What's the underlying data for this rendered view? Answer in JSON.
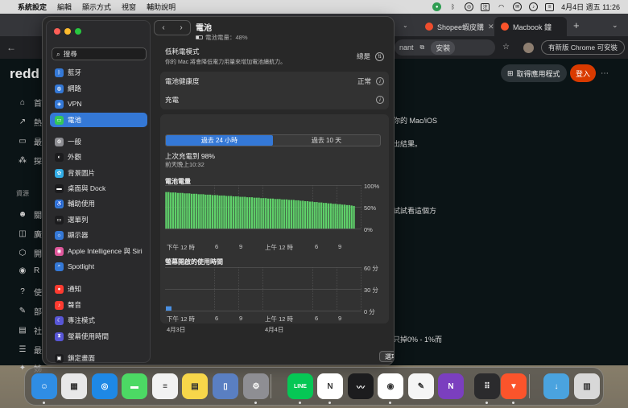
{
  "menubar": {
    "app": "系統設定",
    "items": [
      "編輯",
      "顯示方式",
      "視窗",
      "輔助說明"
    ],
    "status_icons": [
      "github-icon",
      "bluetooth-icon",
      "chatgpt-icon",
      "input-method-icon",
      "wifi-icon",
      "mail-icon",
      "music-icon",
      "control-center-icon"
    ],
    "input_method": "注",
    "datetime": "4月4日 週五 11:26"
  },
  "chrome": {
    "tabs": [
      {
        "label": "Shopee蝦皮購"
      },
      {
        "label": "Macbook 鐘"
      }
    ],
    "address_partial": "nant",
    "install_label": "安裝",
    "update_label": "有新版 Chrome 可安裝",
    "new_tab": "+"
  },
  "reddit": {
    "logo": "redd",
    "get_app": "取得應用程式",
    "login": "登入",
    "section_label": "資源",
    "nav_fragments": [
      "首",
      "熱",
      "最",
      "探",
      "關",
      "廣",
      "開",
      "R",
      "使",
      "部",
      "社",
      "最",
      "姊"
    ],
    "body_text": [
      "你的 Mac/iOS",
      "出結果。",
      "試試看這個方",
      "只掉0% - 1%而"
    ]
  },
  "settings": {
    "search_placeholder": "搜尋",
    "sidebar": [
      {
        "label": "藍牙",
        "icon": "bluetooth-icon",
        "color": "#3478d6"
      },
      {
        "label": "網路",
        "icon": "network-icon",
        "color": "#3478d6"
      },
      {
        "label": "VPN",
        "icon": "vpn-icon",
        "color": "#3478d6"
      },
      {
        "label": "電池",
        "icon": "battery-icon",
        "color": "#34c759",
        "selected": true
      },
      {
        "label": "一般",
        "icon": "gear-icon",
        "color": "#8e8e93"
      },
      {
        "label": "外觀",
        "icon": "appearance-icon",
        "color": "#1c1c1e"
      },
      {
        "label": "背景圖片",
        "icon": "wallpaper-icon",
        "color": "#32ade6"
      },
      {
        "label": "桌面與 Dock",
        "icon": "dock-icon",
        "color": "#1c1c1e"
      },
      {
        "label": "輔助使用",
        "icon": "accessibility-icon",
        "color": "#3478d6"
      },
      {
        "label": "選單列",
        "icon": "menubar-icon",
        "color": "#1c1c1e"
      },
      {
        "label": "顯示器",
        "icon": "display-icon",
        "color": "#3478d6"
      },
      {
        "label": "Apple Intelligence 與 Siri",
        "icon": "siri-icon",
        "color": "#e0579b"
      },
      {
        "label": "Spotlight",
        "icon": "spotlight-icon",
        "color": "#3478d6"
      },
      {
        "label": "通知",
        "icon": "notification-icon",
        "color": "#ff3b30"
      },
      {
        "label": "聲音",
        "icon": "sound-icon",
        "color": "#ff3b30"
      },
      {
        "label": "專注模式",
        "icon": "focus-icon",
        "color": "#5856d6"
      },
      {
        "label": "螢幕使用時間",
        "icon": "screentime-icon",
        "color": "#5856d6"
      },
      {
        "label": "鎖定畫面",
        "icon": "lock-icon",
        "color": "#1c1c1e"
      }
    ],
    "title": "電池",
    "subtitle": "電池電量：48%",
    "battery_level": 0.48,
    "low_power": {
      "label": "低耗電模式",
      "desc": "你的 Mac 將會降低電力用量來增加電池續航力。",
      "value": "總是"
    },
    "health": {
      "label": "電池健康度",
      "value": "正常"
    },
    "charging": {
      "label": "充電"
    },
    "segments": [
      "過去 24 小時",
      "過去 10 天"
    ],
    "last_charge_title": "上次充電到 98%",
    "last_charge_time": "前天晚上10:32",
    "options_label": "選項⋯"
  },
  "chart_data": [
    {
      "type": "bar",
      "title": "電池電量",
      "ylim": [
        0,
        100
      ],
      "yticks": [
        "100%",
        "50%",
        "0%"
      ],
      "xticks": [
        "下午 12 時",
        "6",
        "9",
        "上午 12 時",
        "6",
        "9"
      ],
      "values": [
        84,
        84,
        83,
        83,
        83,
        82,
        82,
        82,
        81,
        81,
        81,
        80,
        80,
        80,
        79,
        79,
        79,
        78,
        78,
        78,
        77,
        77,
        77,
        76,
        76,
        76,
        75,
        75,
        75,
        74,
        74,
        74,
        73,
        73,
        73,
        72,
        72,
        72,
        71,
        71,
        71,
        70,
        70,
        70,
        69,
        69,
        69,
        68,
        68,
        68,
        67,
        67,
        67,
        66,
        66,
        66,
        65,
        65,
        64,
        64,
        63,
        63,
        62,
        62,
        61,
        61,
        60,
        60,
        59,
        59,
        58,
        58,
        57,
        57,
        56,
        56,
        55,
        55,
        54,
        54,
        53,
        52
      ],
      "color": "#5fd06a"
    },
    {
      "type": "bar",
      "title": "螢幕開啟的使用時間",
      "ylim": [
        0,
        60
      ],
      "yticks": [
        "60 分",
        "30 分",
        "0 分"
      ],
      "xticks": [
        "下午 12 時",
        "6",
        "9",
        "上午 12 時",
        "6",
        "9"
      ],
      "xdates": [
        "4月3日",
        "4月4日"
      ],
      "values": [
        6
      ],
      "color": "#4a90e2"
    }
  ],
  "dock": [
    {
      "name": "finder-icon",
      "color": "#2f8de4",
      "glyph": "☺",
      "dot": true
    },
    {
      "name": "launchpad-icon",
      "color": "#e8e8e8",
      "glyph": "▦",
      "dot": false
    },
    {
      "name": "safari-icon",
      "color": "#1e88e5",
      "glyph": "◎",
      "dot": false
    },
    {
      "name": "messages-icon",
      "color": "#4cd964",
      "glyph": "▬",
      "dot": false
    },
    {
      "name": "reminders-icon",
      "color": "#f2f2f2",
      "glyph": "≡",
      "dot": false
    },
    {
      "name": "notes-icon",
      "color": "#f7d64a",
      "glyph": "▤",
      "dot": false
    },
    {
      "name": "preview-icon",
      "color": "#5a7fc2",
      "glyph": "▯",
      "dot": false
    },
    {
      "name": "system-settings-icon",
      "color": "#8e8e93",
      "glyph": "⚙",
      "dot": true
    },
    {
      "name": "line-icon",
      "color": "#06c755",
      "glyph": "LINE",
      "dot": true
    },
    {
      "name": "notion-icon",
      "color": "#ffffff",
      "glyph": "N",
      "dot": true
    },
    {
      "name": "stocks-icon",
      "color": "#1c1c1e",
      "glyph": "〰",
      "dot": false
    },
    {
      "name": "chrome-icon",
      "color": "#ffffff",
      "glyph": "◉",
      "dot": true
    },
    {
      "name": "textedit-icon",
      "color": "#f5f5f5",
      "glyph": "✎",
      "dot": false
    },
    {
      "name": "onenote-icon",
      "color": "#7b3fbf",
      "glyph": "N",
      "dot": false
    },
    {
      "name": "app-grid-icon",
      "color": "#2b2b2d",
      "glyph": "⠿",
      "dot": true
    },
    {
      "name": "brave-icon",
      "color": "#fb542b",
      "glyph": "▼",
      "dot": true
    },
    {
      "name": "downloads-folder-icon",
      "color": "#4aa3df",
      "glyph": "↓",
      "dot": false
    },
    {
      "name": "trash-icon",
      "color": "#d8d8d8",
      "glyph": "▥",
      "dot": false
    }
  ]
}
